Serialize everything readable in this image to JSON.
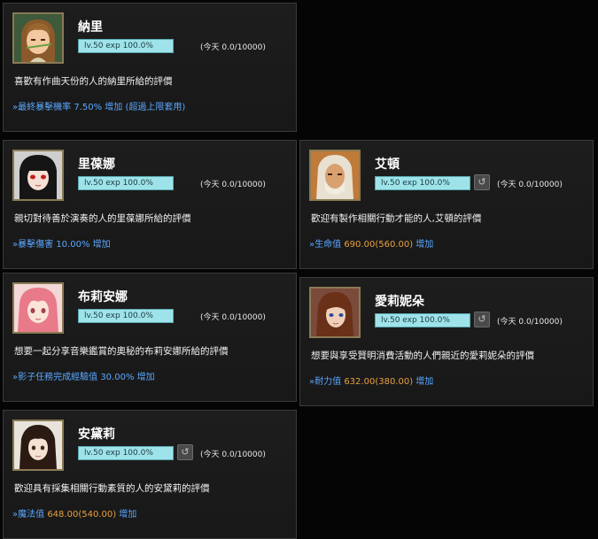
{
  "cards": [
    {
      "name": "納里",
      "level": "lv.50   exp 100.0%",
      "today": "(今天 0.0/10000)",
      "desc": "喜歡有作曲天份的人的納里所給的評價",
      "bonus": {
        "icon": "»",
        "label": "最終暴擊機率 ",
        "value": "7.50%",
        "extra": "",
        "suffix": " 增加 (超過上限套用)"
      }
    },
    {
      "name": "里葆娜",
      "level": "lv.50   exp 100.0%",
      "today": "(今天 0.0/10000)",
      "desc": "親切對待善於演奏的人的里葆娜所給的評價",
      "bonus": {
        "icon": "»",
        "label": "暴擊傷害 ",
        "value": "10.00%",
        "extra": "",
        "suffix": " 增加"
      }
    },
    {
      "name": "艾頓",
      "level": "lv.50   exp 100.0%",
      "today": "(今天 0.0/10000)",
      "desc": "歡迎有製作相關行動才能的人,艾頓的評價",
      "bonus": {
        "icon": "»",
        "label": "生命值 ",
        "value": "690.00",
        "extra": "(560.00)",
        "suffix": " 增加"
      }
    },
    {
      "name": "布莉安娜",
      "level": "lv.50   exp 100.0%",
      "today": "(今天 0.0/10000)",
      "desc": "想要一起分享音樂鑑賞的奧秘的布莉安娜所給的評價",
      "bonus": {
        "icon": "»",
        "label": "影子任務完成經驗值 ",
        "value": "30.00%",
        "extra": "",
        "suffix": " 增加"
      }
    },
    {
      "name": "愛莉妮朵",
      "level": "lv.50   exp 100.0%",
      "today": "(今天 0.0/10000)",
      "desc": "想要與享受賢明消費活動的人們親近的愛莉妮朵的評價",
      "bonus": {
        "icon": "»",
        "label": "耐力值 ",
        "value": "632.00",
        "extra": "(380.00)",
        "suffix": " 增加"
      }
    },
    {
      "name": "安黛莉",
      "level": "lv.50   exp 100.0%",
      "today": "(今天 0.0/10000)",
      "desc": "歡迎具有採集相關行動素質的人的安黛莉的評價",
      "bonus": {
        "icon": "»",
        "label": "魔法值 ",
        "value": "648.00",
        "extra": "(540.00)",
        "suffix": " 增加"
      }
    }
  ],
  "refresh_icon": "refresh-icon",
  "colors": {
    "level_bar": "#9fe3ea",
    "bonus_text": "#5aa8ff",
    "bonus_value": "#e8a040",
    "card_bg": "#1b1b1b"
  }
}
